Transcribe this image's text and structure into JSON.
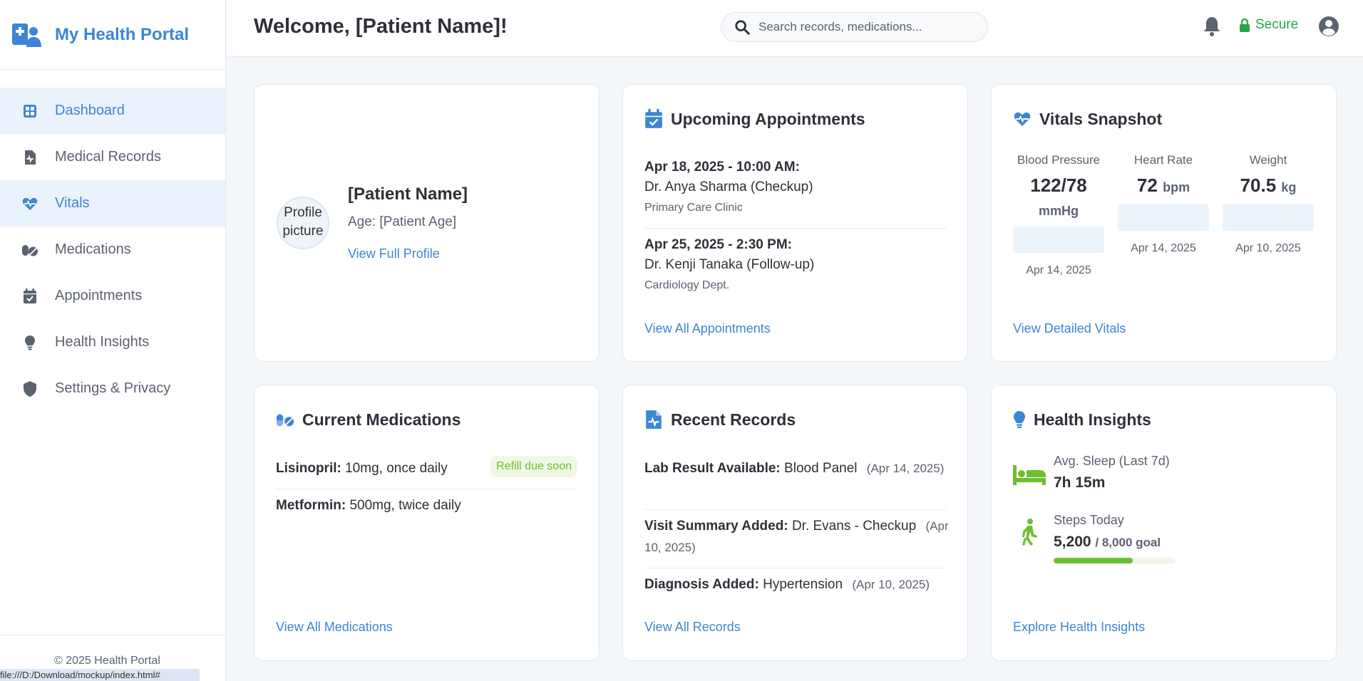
{
  "app": {
    "title": "My Health Portal"
  },
  "sidebar": {
    "items": [
      {
        "label": "Dashboard",
        "icon": "dashboard-icon"
      },
      {
        "label": "Medical Records",
        "icon": "file-medical-icon"
      },
      {
        "label": "Vitals",
        "icon": "heartbeat-icon"
      },
      {
        "label": "Medications",
        "icon": "pills-icon"
      },
      {
        "label": "Appointments",
        "icon": "calendar-check-icon"
      },
      {
        "label": "Health Insights",
        "icon": "lightbulb-icon"
      },
      {
        "label": "Settings & Privacy",
        "icon": "shield-icon"
      }
    ],
    "footer": "© 2025 Health Portal",
    "status_url": "file:///D:/Download/mockup/index.html#"
  },
  "header": {
    "welcome": "Welcome, [Patient Name]!",
    "search_placeholder": "Search records, medications...",
    "secure_label": "Secure"
  },
  "profile": {
    "avatar_alt": "Profile picture",
    "name": "[Patient Name]",
    "age": "Age: [Patient Age]",
    "link": "View Full Profile"
  },
  "appointments": {
    "title": "Upcoming Appointments",
    "items": [
      {
        "datetime": "Apr 18, 2025 - 10:00 AM:",
        "doctor": "Dr. Anya Sharma (Checkup)",
        "location": "Primary Care Clinic"
      },
      {
        "datetime": "Apr 25, 2025 - 2:30 PM:",
        "doctor": "Dr. Kenji Tanaka (Follow-up)",
        "location": "Cardiology Dept."
      }
    ],
    "link": "View All Appointments"
  },
  "vitals": {
    "title": "Vitals Snapshot",
    "items": [
      {
        "label": "Blood Pressure",
        "value": "122/78",
        "unit": "mmHg",
        "date": "Apr 14, 2025"
      },
      {
        "label": "Heart Rate",
        "value": "72",
        "unit": "bpm",
        "date": "Apr 14, 2025"
      },
      {
        "label": "Weight",
        "value": "70.5",
        "unit": "kg",
        "date": "Apr 10, 2025"
      }
    ],
    "link": "View Detailed Vitals"
  },
  "medications": {
    "title": "Current Medications",
    "items": [
      {
        "name": "Lisinopril:",
        "dose": "10mg, once daily",
        "badge": "Refill due soon"
      },
      {
        "name": "Metformin:",
        "dose": "500mg, twice daily"
      }
    ],
    "link": "View All Medications"
  },
  "records": {
    "title": "Recent Records",
    "items": [
      {
        "type": "Lab Result Available:",
        "detail": "Blood Panel",
        "date": "(Apr 14, 2025)"
      },
      {
        "type": "Visit Summary Added:",
        "detail": "Dr. Evans - Checkup",
        "date": "(Apr 10, 2025)"
      },
      {
        "type": "Diagnosis Added:",
        "detail": "Hypertension",
        "date": "(Apr 10, 2025)"
      }
    ],
    "link": "View All Records"
  },
  "insights": {
    "title": "Health Insights",
    "sleep": {
      "label": "Avg. Sleep (Last 7d)",
      "value": "7h 15m"
    },
    "steps": {
      "label": "Steps Today",
      "value": "5,200",
      "goal": "/ 8,000 goal",
      "progress_pct": 65
    },
    "link": "Explore Health Insights"
  },
  "colors": {
    "accent": "#3d85d6",
    "secure": "#27a745",
    "success": "#6dbf2f",
    "active_bg": "#eaf2fc"
  }
}
